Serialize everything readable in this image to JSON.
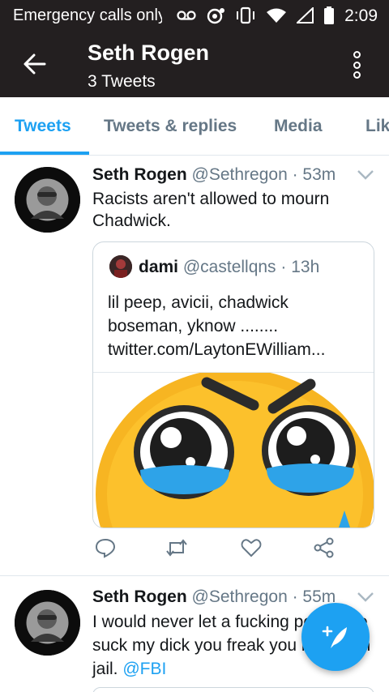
{
  "status_bar": {
    "carrier_text": "Emergency calls only",
    "time": "2:09",
    "icons": [
      "voicemail-icon",
      "alarm-icon",
      "vibrate-icon",
      "wifi-icon",
      "signal-icon",
      "battery-icon"
    ]
  },
  "header": {
    "title": "Seth Rogen",
    "subtitle": "3 Tweets"
  },
  "tabs": [
    {
      "label": "Tweets",
      "active": true
    },
    {
      "label": "Tweets & replies",
      "active": false
    },
    {
      "label": "Media",
      "active": false
    },
    {
      "label": "Likes",
      "active": false
    }
  ],
  "tweets": [
    {
      "name": "Seth Rogen",
      "handle": "@Sethregon",
      "time": "· 53m",
      "text": "Racists aren't allowed to mourn Chadwick.",
      "quote": {
        "name": "dami",
        "handle": "@castellqns",
        "time": "· 13h",
        "lines": [
          "lil peep, avicii, chadwick",
          "boseman, yknow ........",
          "twitter.com/LaytonEWilliam..."
        ]
      }
    },
    {
      "name": "Seth Rogen",
      "handle": "@Sethregon",
      "time": "· 55m",
      "text": "I would never let a fucking pedophile suck my dick you freak you belong in jail.",
      "mention": "@FBI"
    }
  ],
  "colors": {
    "accent": "#1da1f2",
    "app_bar": "#231f20",
    "secondary_text": "#657786"
  }
}
